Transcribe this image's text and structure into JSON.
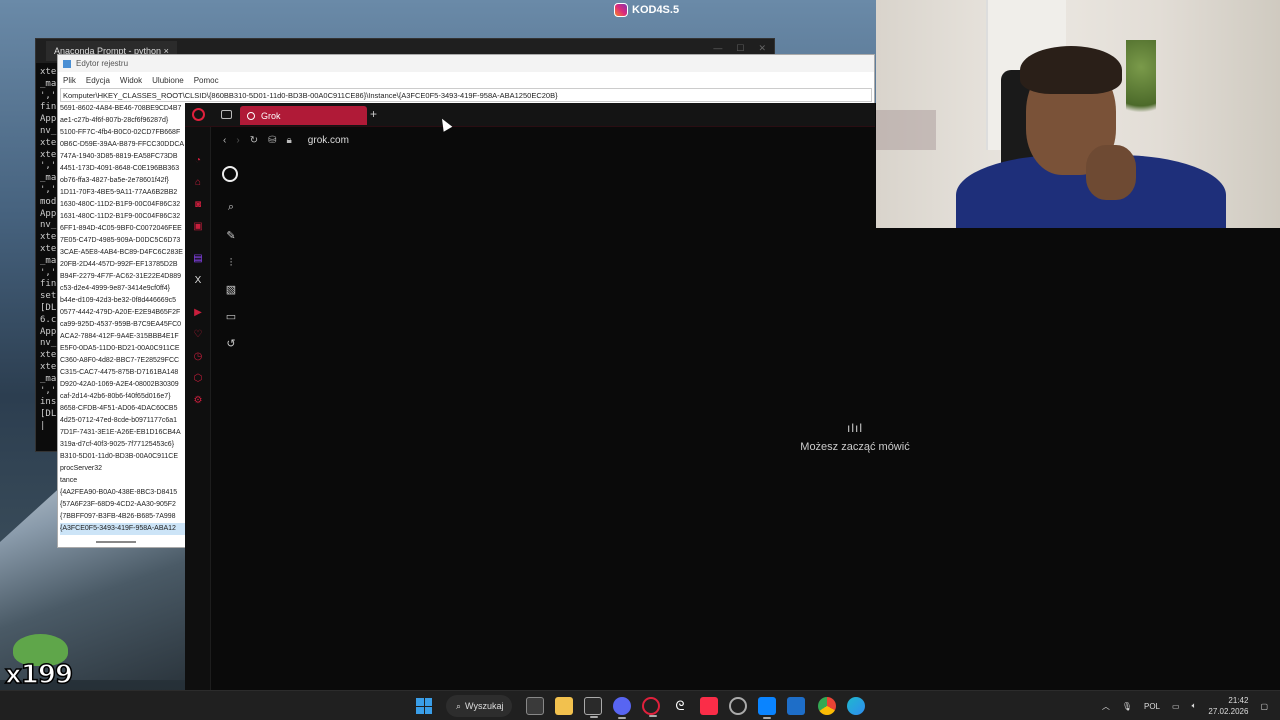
{
  "terminal": {
    "tab_title": "Anaconda Prompt - python  ×",
    "lines": [
      "xte",
      "_ma",
      "','",
      "fin",
      "App",
      "nv_",
      "xte",
      "xte",
      "','",
      "_ma",
      "','",
      "mod",
      "App",
      "nv_",
      "xte",
      "xte",
      "_ma",
      "','",
      "fin",
      "set",
      "[DL",
      "6.c",
      "App",
      "nv_",
      "xte",
      "xte",
      "_ma",
      "','",
      "ins",
      "[DL",
      "|"
    ]
  },
  "registry": {
    "title": "Edytor rejestru",
    "menu": [
      "Plik",
      "Edycja",
      "Widok",
      "Ulubione",
      "Pomoc"
    ],
    "address": "Komputer\\HKEY_CLASSES_ROOT\\CLSID\\{860BB310-5D01-11d0-BD3B-00A0C911CE86}\\Instance\\{A3FCE0F5-3493-419F-958A-ABA1250EC20B}",
    "keys": [
      "5691-8602-4A84-BE46-708BE9CD4B7",
      "ae1-c27b-4f6f-807b-28cf6f96287d}",
      "5100-FF7C-4fb4-B0C0-02CD7FB668F",
      "0B6C-D59E-39AA-B879-FFCC30DDCA",
      "747A-1940-3D85-8819-EA58FC73DB",
      "4451-173D-4091-8648-C0E196BB363",
      "ob76-ffa3-4827-ba5e-2e78601f42f}",
      "1D11-70F3-4BE5-9A11-77AA6B2BB2",
      "1630-480C-11D2-B1F9-00C04F86C32",
      "1631-480C-11D2-B1F9-00C04F86C32",
      "6FF1-894D-4C05-9BF0-C0072046FEE",
      "7E05-C47D-4985-909A-D0DC5C6D73",
      "3CAE-A5E8-4AB4-BC89-D4FC6C283E",
      "20FB-2D44-457D-992F-EF13785D2B",
      "B94F-2279-4F7F-AC62-31E22E4D889",
      "c53-d2e4-4999-9e87-3414e9cf0ff4}",
      "b44e-d109-42d3-be32-0f8d446669c5",
      "0577-4442-479D-A20E-E2E94B65F2F",
      "ca99-925D-4537-959B-B7C9EA45FC0",
      "ACA2-7884-412F-9A4E-315BBB4E1F",
      "E5F0-0DA5-11D0-BD21-00A0C911CE",
      "C360-A8F0-4d82-BBC7-7E28529FCC",
      "C315-CAC7-4475-875B-D7161BA148",
      "D920-42A0-1069-A2E4-08002B30309",
      "caf-2d14-42b6-80b6-f40f65d016e7}",
      "8658-CFDB-4F51-AD06-4DAC60CB5",
      "4d25-0712-47ed-8cde-b0971177c6a1",
      "7D1F-7431-3E1E-A26E-EB1D16CB4A",
      "319a-d7cf-40f3-9025-7f77125453c6}",
      "B310-5D01-11d0-BD3B-00A0C911CE",
      "procServer32",
      "tance",
      "{4A2FEA90-B0A0-438E-8BC3-D8415",
      "{57A6F23F-68D9-4CD2-AA30-905F2",
      "{7BBFF097-B3FB-4B26-B685-7A998",
      "{A3FCE0F5-3493-419F-958A-ABA12"
    ]
  },
  "browser": {
    "tab_title": "Grok",
    "new_tab": "+",
    "url": "grok.com",
    "voice_message": "Możesz zacząć mówić",
    "accent": "#b01a37"
  },
  "overlay": {
    "instagram": "KOD4S.5",
    "viewer_count": "x199"
  },
  "taskbar": {
    "search_label": "Wyszukaj",
    "language": "POL",
    "time": "21:42",
    "date": "27.02.2026"
  }
}
